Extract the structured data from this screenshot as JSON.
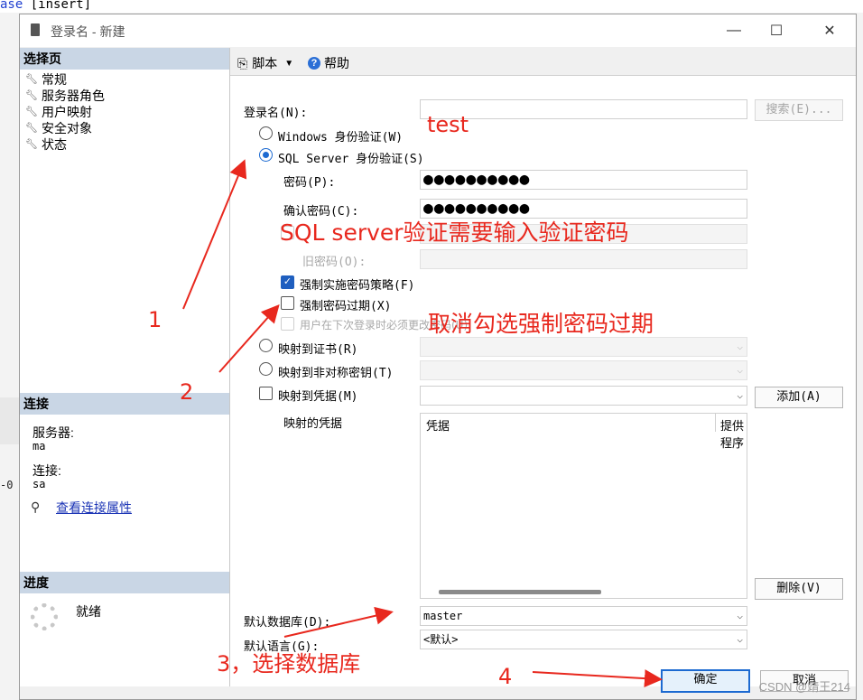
{
  "background": {
    "editor_text_keyword": "ase",
    "editor_text_rest": " [insert]",
    "line_number_fragment": "-0"
  },
  "window": {
    "title": "登录名 - 新建",
    "minimize_glyph": "—",
    "maximize_glyph": "☐",
    "close_glyph": "✕"
  },
  "left_panel": {
    "select_page_header": "选择页",
    "pages": [
      {
        "label": "常规"
      },
      {
        "label": "服务器角色"
      },
      {
        "label": "用户映射"
      },
      {
        "label": "安全对象"
      },
      {
        "label": "状态"
      }
    ],
    "connection_header": "连接",
    "server_label": "服务器:",
    "server_value": "ma",
    "connection_label": "连接:",
    "connection_value": "sa",
    "view_props_link": "查看连接属性",
    "progress_header": "进度",
    "progress_status": "就绪"
  },
  "toolbar": {
    "script_label": "脚本",
    "help_label": "帮助"
  },
  "form": {
    "login_name_label": "登录名(N):",
    "login_name_value": "",
    "search_button": "搜索(E)...",
    "windows_auth_label": "Windows 身份验证(W)",
    "sql_auth_label": "SQL Server 身份验证(S)",
    "auth_mode_selected": "sql_server",
    "password_label": "密码(P):",
    "password_value": "●●●●●●●●●●",
    "confirm_label": "确认密码(C):",
    "confirm_value": "●●●●●●●●●●",
    "old_password_label": "旧密码(O):",
    "enforce_policy_label": "强制实施密码策略(F)",
    "enforce_policy_checked": true,
    "enforce_expiration_label": "强制密码过期(X)",
    "enforce_expiration_checked": false,
    "must_change_label": "用户在下次登录时必须更改密码(U)",
    "must_change_checked": false,
    "map_cert_label": "映射到证书(R)",
    "map_asym_label": "映射到非对称密钥(T)",
    "map_cred_label": "映射到凭据(M)",
    "add_button": "添加(A)",
    "mapped_creds_label": "映射的凭据",
    "grid_col_credential": "凭据",
    "grid_col_provider": "提供程序",
    "remove_button": "删除(V)",
    "default_db_label": "默认数据库(D):",
    "default_db_value": "master",
    "default_lang_label": "默认语言(G):",
    "default_lang_value": "<默认>",
    "ok_button": "确定",
    "cancel_button": "取消"
  },
  "annotations": {
    "test_note": "test",
    "sql_note": "SQL server验证需要输入验证密码",
    "uncheck_note": "取消勾选强制密码过期",
    "step1": "1",
    "step2": "2",
    "step3": "3，选择数据库",
    "step4": "4",
    "annotation_color": "#e8281e"
  },
  "watermark": "CSDN @靖王214",
  "colors": {
    "accent": "#1c6ad1",
    "section_header": "#c9d6e5",
    "link": "#1a33b5"
  }
}
